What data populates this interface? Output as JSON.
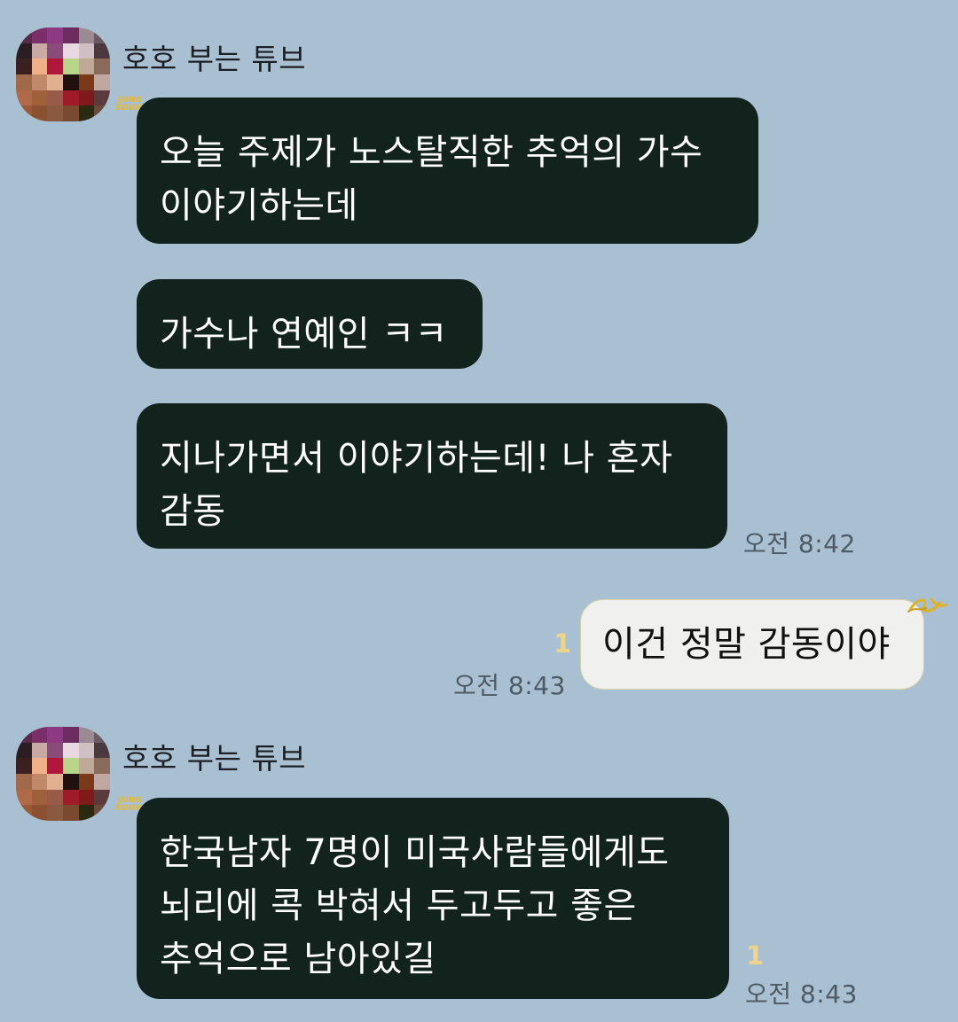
{
  "colors": {
    "background": "#a9c0d3",
    "incoming_bubble": "#12221c",
    "outgoing_bubble": "#f0f0ee",
    "unread": "#efd58c",
    "timestamp": "#4e5a64"
  },
  "messages": {
    "group1": {
      "sender": "호호 부는 튜브",
      "badge_top": "JUNG",
      "badge_bottom": "KOOK",
      "bubble1": {
        "line1": "오늘 주제가 노스탈직한 추억의 가수",
        "line2": "이야기하는데"
      },
      "bubble2": {
        "line1": "가수나 연예인 ㅋㅋ"
      },
      "bubble3": {
        "line1": "지나가면서 이야기하는데! 나 혼자",
        "line2": "감동"
      },
      "time": "오전 8:42"
    },
    "mine": {
      "text": "이건 정말 감동이야",
      "unread": "1",
      "time": "오전 8:43",
      "decoration_icon": "gold-ribbon-icon"
    },
    "group2": {
      "sender": "호호 부는 튜브",
      "badge_top": "JUNG",
      "badge_bottom": "KOOK",
      "bubble1": {
        "line1": "한국남자 7명이 미국사람들에게도",
        "line2": "뇌리에 콕 박혀서 두고두고 좋은",
        "line3": "추억으로 남아있길"
      },
      "unread": "1",
      "time": "오전 8:43"
    }
  }
}
